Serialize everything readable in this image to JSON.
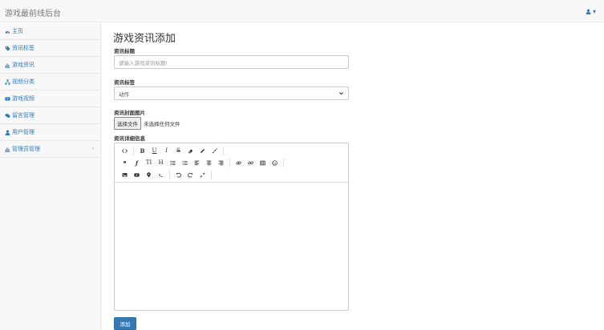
{
  "app": {
    "brand": "游戏最前线后台"
  },
  "user_menu": {
    "icon": "user-icon",
    "caret": "▾"
  },
  "sidebar": {
    "items": [
      {
        "label": "主页",
        "icon": "dashboard-icon"
      },
      {
        "label": "资讯标签",
        "icon": "tag-icon"
      },
      {
        "label": "游戏资讯",
        "icon": "bar-chart-icon"
      },
      {
        "label": "视频分类",
        "icon": "sitemap-icon"
      },
      {
        "label": "游戏视频",
        "icon": "video-icon"
      },
      {
        "label": "留言管理",
        "icon": "comments-icon"
      },
      {
        "label": "用户管理",
        "icon": "user-icon"
      },
      {
        "label": "管理员管理",
        "icon": "bar-chart-icon",
        "caret": "‹"
      }
    ]
  },
  "form": {
    "title": "游戏资讯添加",
    "title_label": "资讯标题",
    "title_placeholder": "请输入游戏资讯标题!",
    "tag_label": "资讯标签",
    "tag_selected": "动作",
    "cover_label": "资讯封面图片",
    "file_button": "选择文件",
    "file_status": "未选择任何文件",
    "detail_label": "资讯详细信息",
    "submit": "添加"
  },
  "editor_toolbar": {
    "row1": [
      "code-view-icon",
      "bold-icon",
      "underline-icon",
      "italic-icon",
      "strikethrough-icon",
      "eraser-icon",
      "pencil-icon",
      "brush-icon"
    ],
    "row1_text": {
      "bold": "B",
      "underline": "U",
      "italic": "I",
      "strike": "S"
    },
    "row2": [
      "quote-icon",
      "font-icon",
      "text-height-icon",
      "heading-icon",
      "list-ul-icon",
      "list-ol-icon",
      "align-left-icon",
      "align-center-icon",
      "align-right-icon",
      "link-icon",
      "unlink-icon",
      "table-icon",
      "emoji-icon"
    ],
    "row2_text": {
      "quote": "❝",
      "font": "ƒ",
      "text_height": "TI",
      "heading": "H"
    },
    "row3": [
      "image-icon",
      "video-icon",
      "map-marker-icon",
      "terminal-icon",
      "undo-icon",
      "redo-icon",
      "fullscreen-icon"
    ]
  },
  "colors": {
    "accent": "#337ab7",
    "navbar_bg": "#f8f8f8",
    "border": "#e7e7e7"
  }
}
